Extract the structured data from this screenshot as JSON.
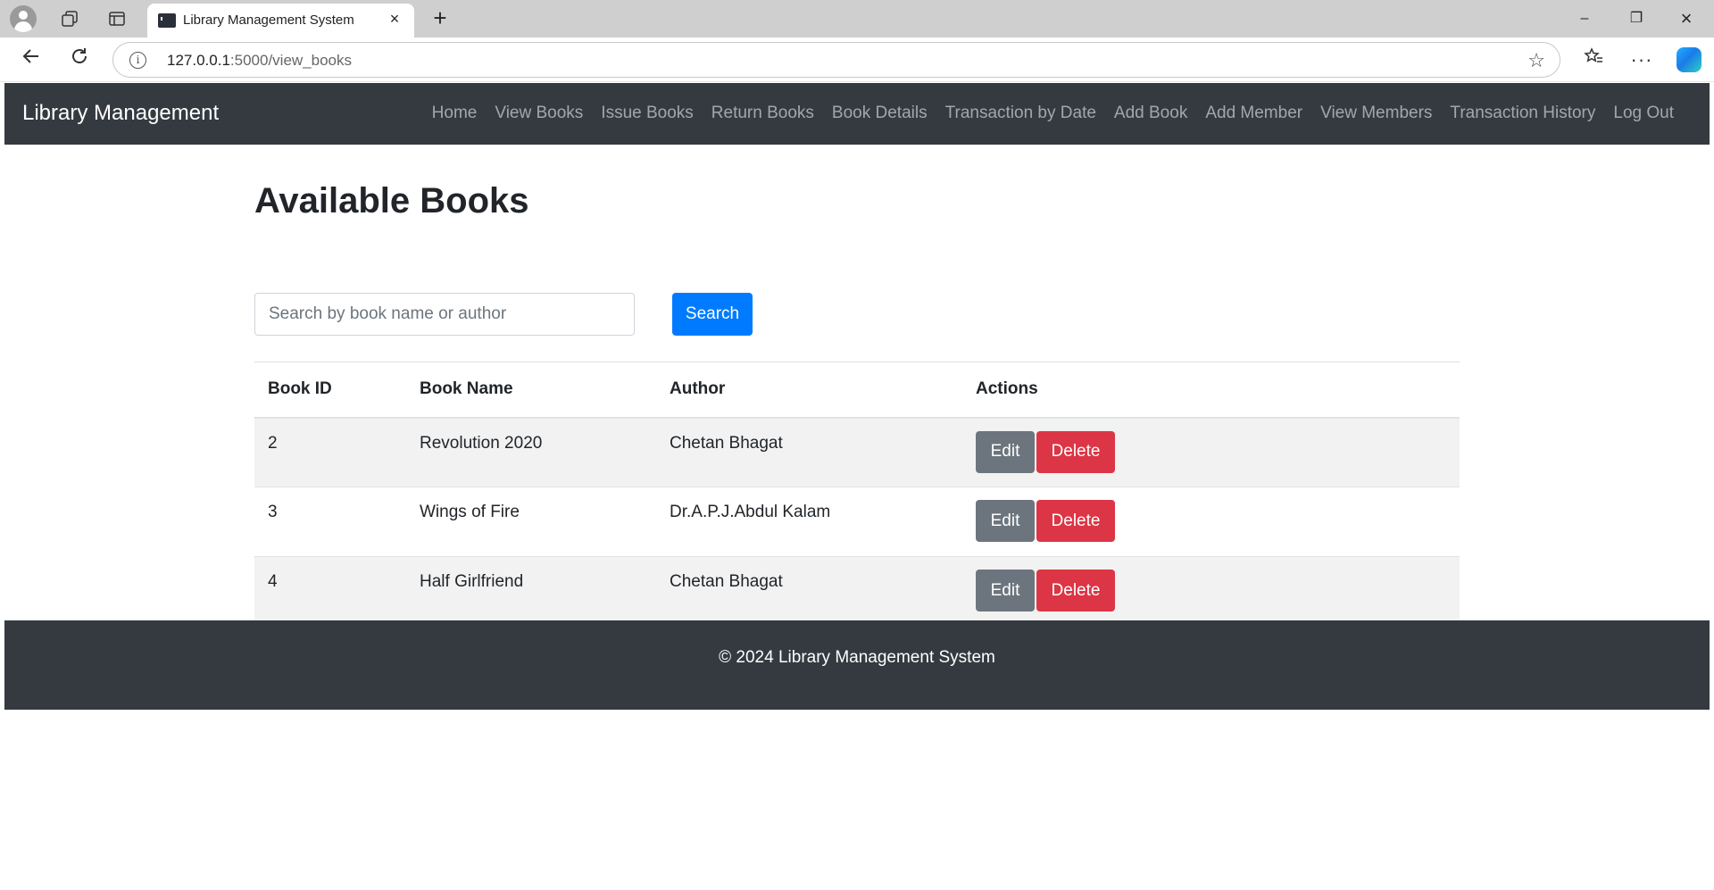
{
  "browser": {
    "tab_title": "Library Management System",
    "tab_close": "×",
    "new_tab": "+",
    "url_host": "127.0.0.1",
    "url_rest": ":5000/view_books",
    "window_controls": {
      "minimize": "–",
      "maximize": "❐",
      "close": "×"
    },
    "icons": [
      "profile-icon",
      "workspaces-icon",
      "tabs-icon",
      "back-icon",
      "reload-icon",
      "info-icon",
      "favorite-star-icon",
      "favorites-icon",
      "more-icon",
      "copilot-icon"
    ]
  },
  "navbar": {
    "brand": "Library Management",
    "links": [
      "Home",
      "View Books",
      "Issue Books",
      "Return Books",
      "Book Details",
      "Transaction by Date",
      "Add Book",
      "Add Member",
      "View Members",
      "Transaction History",
      "Log Out"
    ]
  },
  "main": {
    "heading": "Available Books",
    "search": {
      "placeholder": "Search by book name or author",
      "value": "",
      "button": "Search"
    },
    "table": {
      "headers": [
        "Book ID",
        "Book Name",
        "Author",
        "Actions"
      ],
      "rows": [
        {
          "id": "2",
          "name": "Revolution 2020",
          "author": "Chetan Bhagat"
        },
        {
          "id": "3",
          "name": "Wings of Fire",
          "author": "Dr.A.P.J.Abdul Kalam"
        },
        {
          "id": "4",
          "name": "Half Girlfriend",
          "author": "Chetan Bhagat"
        }
      ],
      "edit_label": "Edit",
      "delete_label": "Delete"
    }
  },
  "footer": {
    "text": "© 2024 Library Management System"
  },
  "colors": {
    "navbar": "#343a40",
    "primary": "#007bff",
    "secondary": "#6c757d",
    "danger": "#dc3545"
  }
}
